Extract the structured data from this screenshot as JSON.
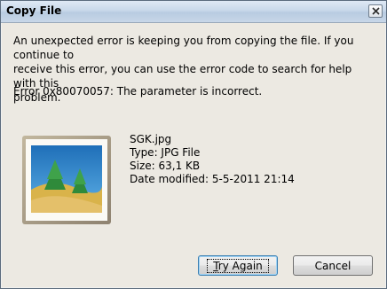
{
  "window": {
    "title": "Copy File"
  },
  "message": {
    "line1": "An unexpected error is keeping you from copying the file. If you continue to",
    "line2": "receive this error, you can use the error code to search for help with this",
    "line3": "problem.",
    "error": "Error 0x80070057: The parameter is incorrect."
  },
  "file": {
    "name": "SGK.jpg",
    "type": "Type: JPG File",
    "size": "Size: 63,1 KB",
    "modified": "Date modified: 5-5-2011 21:14",
    "icon": "image-file-icon"
  },
  "buttons": {
    "try_again_mnemonic": "T",
    "try_again_rest": "ry Again",
    "cancel": "Cancel"
  },
  "icons": {
    "close": "close-icon"
  },
  "colors": {
    "titlebar": "#c8d8ea",
    "dialog_bg": "#ece9e2",
    "default_button_border": "#3c7fb1"
  }
}
